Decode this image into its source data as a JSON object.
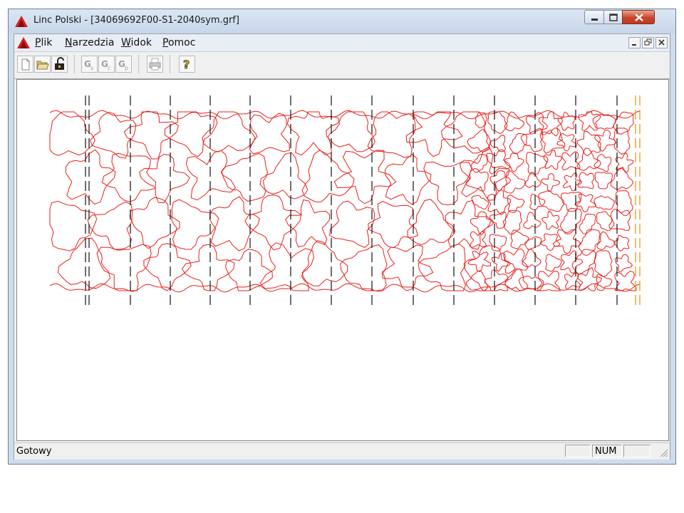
{
  "window": {
    "title": "Linc Polski - [34069692F00-S1-2040sym.grf]",
    "buttons": {
      "minimize": "minimize",
      "maximize": "maximize",
      "close": "close"
    },
    "accent": "#d42020"
  },
  "menu": {
    "items": [
      {
        "key": "P",
        "rest": "lik"
      },
      {
        "key": "N",
        "rest": "arzedzia"
      },
      {
        "key": "W",
        "rest": "idok"
      },
      {
        "key": "P",
        "rest": "omoc"
      }
    ]
  },
  "toolbar": {
    "buttons": [
      {
        "icon": "new-file-icon",
        "enabled": true
      },
      {
        "icon": "open-folder-icon",
        "enabled": true
      },
      {
        "icon": "unlock-icon",
        "enabled": true
      },
      {
        "icon": "generate-s-icon",
        "enabled": false
      },
      {
        "icon": "generate-c-icon",
        "enabled": false
      },
      {
        "icon": "generate-p-icon",
        "enabled": false
      },
      {
        "icon": "print-icon",
        "enabled": false
      },
      {
        "icon": "help-icon",
        "enabled": true
      }
    ]
  },
  "drawing": {
    "shape_color": "#e8201c",
    "cut_line_color": "#111111",
    "edge_line_color": "#f0a020"
  },
  "status": {
    "text": "Gotowy",
    "num": "NUM"
  }
}
